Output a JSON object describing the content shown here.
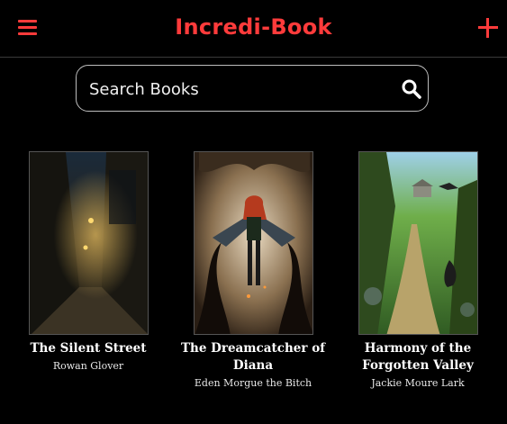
{
  "header": {
    "title": "Incredi-Book",
    "menu_icon": "hamburger-menu-icon",
    "add_icon": "plus-icon",
    "accent_color": "#ff3b3b"
  },
  "search": {
    "placeholder": "Search Books",
    "value": "",
    "icon": "search-icon"
  },
  "books": [
    {
      "title": "The Silent Street",
      "author": "Rowan Glover",
      "cover": "dark alley at night with lit lamps"
    },
    {
      "title": "The Dreamcatcher of Diana",
      "author": "Eden Morgue the Bitch",
      "cover": "winged woman with dark tentacles"
    },
    {
      "title": "Harmony of the Forgotten Valley",
      "author": "Jackie Moure Lark",
      "cover": "sunlit forest path with crows"
    }
  ]
}
